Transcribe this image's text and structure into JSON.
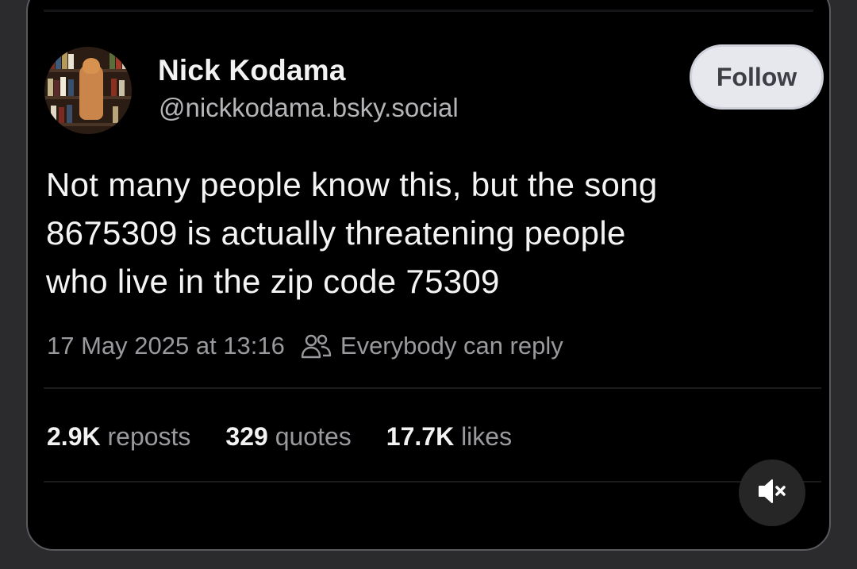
{
  "author": {
    "name": "Nick Kodama",
    "handle": "@nickkodama.bsky.social",
    "avatar_icon": "avatar-cat-bookshelf-icon"
  },
  "follow_label": "Follow",
  "post": {
    "lines": [
      "Not many people know this, but the song",
      "8675309 is actually threatening people",
      "who live in the zip code 75309"
    ]
  },
  "meta": {
    "timestamp": "17 May 2025 at 13:16",
    "reply_setting_icon": "people-icon",
    "reply_setting": "Everybody can reply"
  },
  "stats": {
    "reposts_count": "2.9K",
    "reposts_label": "reposts",
    "quotes_count": "329",
    "quotes_label": "quotes",
    "likes_count": "17.7K",
    "likes_label": "likes"
  },
  "media_control": {
    "icon": "muted-speaker-icon"
  },
  "colors": {
    "background": "#000000",
    "follow_button": "#e6e8ee",
    "muted_text": "#9a9a9e"
  }
}
